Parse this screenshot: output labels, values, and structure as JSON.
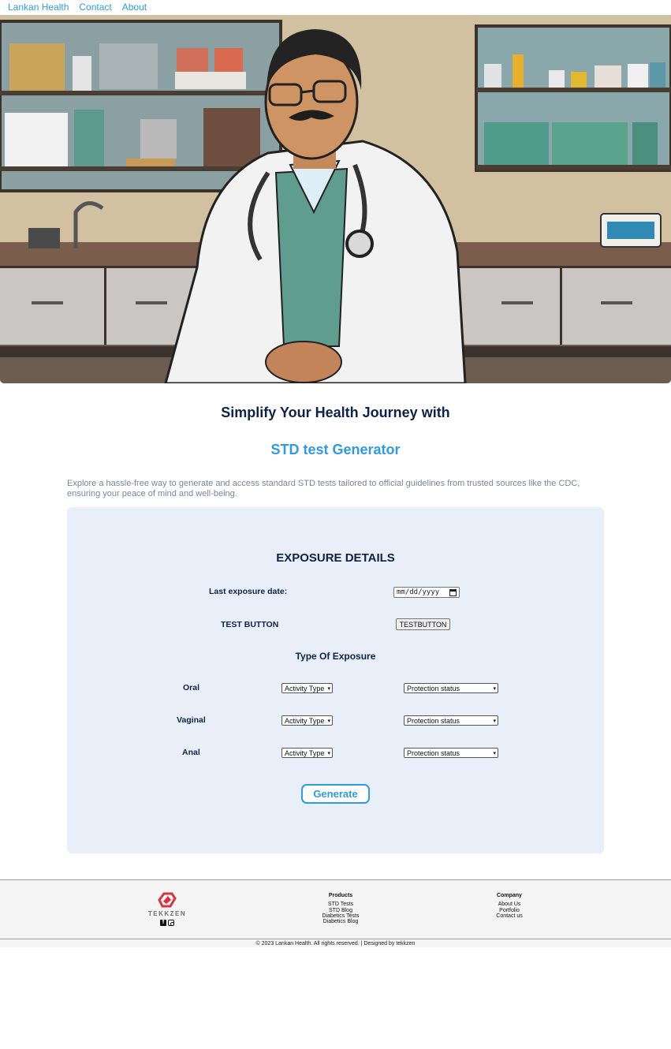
{
  "nav": {
    "brand": "Lankan Health",
    "links": [
      "Contact",
      "About"
    ]
  },
  "hero": {
    "image": "doctor-illustration",
    "alt_description": "illustrated doctor in white coat with stethoscope sitting in a clinic"
  },
  "headline": {
    "line1": "Simplify Your Health Journey with",
    "line2": "STD test Generator",
    "intro": "Explore a hassle-free way to generate and access standard STD tests tailored to official guidelines from trusted sources like the CDC, ensuring your peace of mind and well-being."
  },
  "form": {
    "title": "EXPOSURE DETAILS",
    "exposure_date_label": "Last exposure date:",
    "exposure_date_placeholder": "mm/dd/yyyy",
    "test_label": "TEST BUTTON",
    "test_button": "TESTBUTTON",
    "type_title": "Type Of Exposure",
    "rows": [
      {
        "label": "Oral",
        "activity": "Activity Type",
        "protection": "Protection status"
      },
      {
        "label": "Vaginal",
        "activity": "Activity Type",
        "protection": "Protection status"
      },
      {
        "label": "Anal",
        "activity": "Activity Type",
        "protection": "Protection status"
      }
    ],
    "generate_button": "Generate"
  },
  "footer": {
    "logo_text": "TEKKZEN",
    "products": {
      "heading": "Products",
      "items": [
        "STD Tests",
        "STD Blog",
        "Diabetics Tests",
        "Diabetics Blog"
      ]
    },
    "company": {
      "heading": "Company",
      "items": [
        "About Us",
        "Portfolio",
        "Contact us"
      ]
    },
    "copyright": "© 2023 Lankan Health. All rights reserved. | Designed by tekkzen"
  },
  "colors": {
    "accent": "#2f9be2",
    "navy": "#0f2146",
    "card_bg": "#e8eff9",
    "logo_red": "#d9333f"
  }
}
